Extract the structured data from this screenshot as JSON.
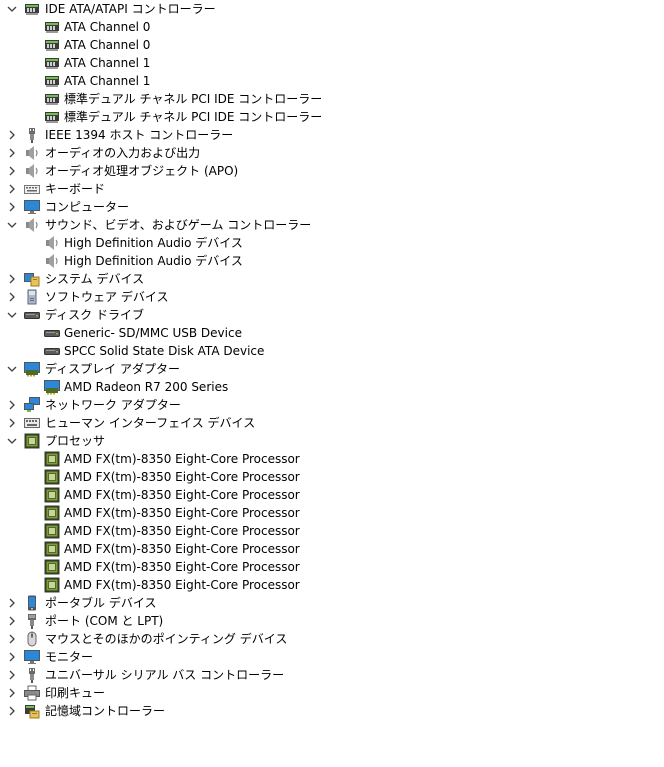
{
  "tree": [
    {
      "label": "IDE ATA/ATAPI コントローラー",
      "icon": "ide-controller-icon",
      "expanded": true,
      "children": [
        {
          "label": "ATA Channel 0",
          "icon": "ide-controller-icon"
        },
        {
          "label": "ATA Channel 0",
          "icon": "ide-controller-icon"
        },
        {
          "label": "ATA Channel 1",
          "icon": "ide-controller-icon"
        },
        {
          "label": "ATA Channel 1",
          "icon": "ide-controller-icon"
        },
        {
          "label": "標準デュアル チャネル PCI IDE コントローラー",
          "icon": "ide-controller-icon"
        },
        {
          "label": "標準デュアル チャネル PCI IDE コントローラー",
          "icon": "ide-controller-icon"
        }
      ]
    },
    {
      "label": "IEEE 1394 ホスト コントローラー",
      "icon": "usb-plug-icon",
      "expanded": false
    },
    {
      "label": "オーディオの入力および出力",
      "icon": "speaker-icon",
      "expanded": false
    },
    {
      "label": "オーディオ処理オブジェクト (APO)",
      "icon": "speaker-icon",
      "expanded": false
    },
    {
      "label": "キーボード",
      "icon": "keyboard-icon",
      "expanded": false
    },
    {
      "label": "コンピューター",
      "icon": "monitor-icon",
      "expanded": false
    },
    {
      "label": "サウンド、ビデオ、およびゲーム コントローラー",
      "icon": "speaker-icon",
      "expanded": true,
      "children": [
        {
          "label": "High Definition Audio デバイス",
          "icon": "speaker-icon"
        },
        {
          "label": "High Definition Audio デバイス",
          "icon": "speaker-icon"
        }
      ]
    },
    {
      "label": "システム デバイス",
      "icon": "system-folder-icon",
      "expanded": false
    },
    {
      "label": "ソフトウェア デバイス",
      "icon": "software-device-icon",
      "expanded": false
    },
    {
      "label": "ディスク ドライブ",
      "icon": "disk-drive-icon",
      "expanded": true,
      "children": [
        {
          "label": "Generic- SD/MMC USB Device",
          "icon": "disk-drive-icon"
        },
        {
          "label": "SPCC Solid State Disk ATA Device",
          "icon": "disk-drive-icon"
        }
      ]
    },
    {
      "label": "ディスプレイ アダプター",
      "icon": "display-adapter-icon",
      "expanded": true,
      "children": [
        {
          "label": "AMD Radeon R7 200 Series",
          "icon": "display-adapter-icon"
        }
      ]
    },
    {
      "label": "ネットワーク アダプター",
      "icon": "network-adapter-icon",
      "expanded": false
    },
    {
      "label": "ヒューマン インターフェイス デバイス",
      "icon": "hid-icon",
      "expanded": false
    },
    {
      "label": "プロセッサ",
      "icon": "processor-icon",
      "expanded": true,
      "children": [
        {
          "label": "AMD FX(tm)-8350 Eight-Core Processor",
          "icon": "processor-icon"
        },
        {
          "label": "AMD FX(tm)-8350 Eight-Core Processor",
          "icon": "processor-icon"
        },
        {
          "label": "AMD FX(tm)-8350 Eight-Core Processor",
          "icon": "processor-icon"
        },
        {
          "label": "AMD FX(tm)-8350 Eight-Core Processor",
          "icon": "processor-icon"
        },
        {
          "label": "AMD FX(tm)-8350 Eight-Core Processor",
          "icon": "processor-icon"
        },
        {
          "label": "AMD FX(tm)-8350 Eight-Core Processor",
          "icon": "processor-icon"
        },
        {
          "label": "AMD FX(tm)-8350 Eight-Core Processor",
          "icon": "processor-icon"
        },
        {
          "label": "AMD FX(tm)-8350 Eight-Core Processor",
          "icon": "processor-icon"
        }
      ]
    },
    {
      "label": "ポータブル デバイス",
      "icon": "portable-device-icon",
      "expanded": false
    },
    {
      "label": "ポート (COM と LPT)",
      "icon": "port-icon",
      "expanded": false
    },
    {
      "label": "マウスとそのほかのポインティング デバイス",
      "icon": "mouse-icon",
      "expanded": false
    },
    {
      "label": "モニター",
      "icon": "monitor-icon",
      "expanded": false
    },
    {
      "label": "ユニバーサル シリアル バス コントローラー",
      "icon": "usb-plug-icon",
      "expanded": false
    },
    {
      "label": "印刷キュー",
      "icon": "printer-icon",
      "expanded": false
    },
    {
      "label": "記憶域コントローラー",
      "icon": "storage-controller-icon",
      "expanded": false
    }
  ],
  "colors": {
    "chevron": "#404040",
    "monitor_blue": "#2b88d8",
    "chip_green": "#4e6b2a",
    "gray": "#7a7a7a"
  }
}
